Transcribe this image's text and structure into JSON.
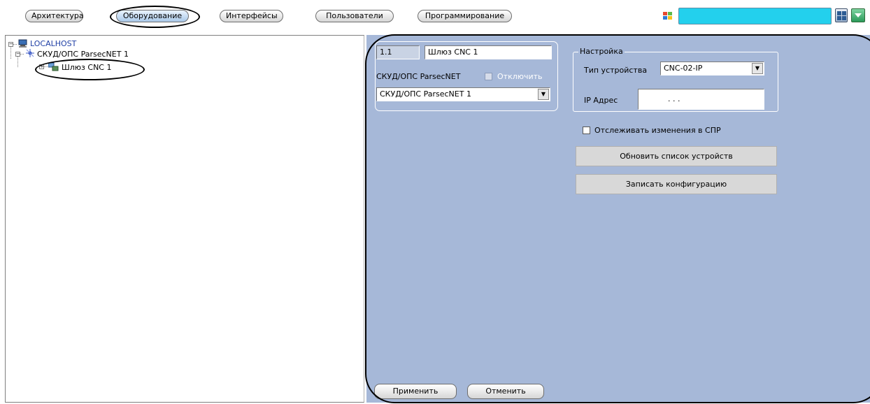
{
  "toolbar": {
    "tabs": [
      {
        "label": "Архитектура"
      },
      {
        "label": "Оборудование"
      },
      {
        "label": "Интерфейсы"
      },
      {
        "label": "Пользователи"
      },
      {
        "label": "Программирование"
      }
    ],
    "active_tab": "Оборудование",
    "accent_color": "#23d0ed"
  },
  "tree": {
    "root": {
      "label": "LOCALHOST",
      "icon": "computer-icon"
    },
    "child": {
      "label": "СКУД/ОПС ParsecNET 1",
      "icon": "network-icon"
    },
    "grandchild": {
      "label": "Шлюз CNC 1",
      "icon": "gateway-icon"
    }
  },
  "settings": {
    "id_value": "1.1",
    "name_value": "Шлюз CNC 1",
    "parent_label": "СКУД/ОПС ParsecNET",
    "disable_label": "Отключить",
    "parent_select": "СКУД/ОПС ParsecNET 1",
    "group_title": "Настройка",
    "device_type_label": "Тип устройства",
    "device_type_value": "CNC-02-IP",
    "ip_label": "IP Адрес",
    "ip_value": ".       .       .",
    "track_changes_label": "Отслеживать изменения в СПР",
    "refresh_button": "Обновить список устройств",
    "write_button": "Записать конфигурацию",
    "panel_color": "#a6b8d8"
  },
  "footer": {
    "apply_button": "Применить",
    "cancel_button": "Отменить"
  }
}
